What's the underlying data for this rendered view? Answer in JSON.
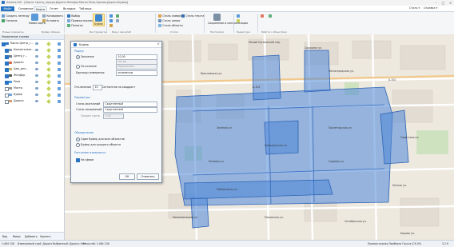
{
  "titlebar": {
    "text": "Axioma.GIS - [Карта: Центр_города.Дороги.ЖелДор.Мосты,Реки,Здания,Дороги,Буфер]"
  },
  "menu": {
    "file": "Файл",
    "tabs": [
      "Основные",
      "Карта",
      "Отчет",
      "Вкладка",
      "Таблица"
    ],
    "active": "Карта",
    "right": [
      "Стиль ▾",
      "Справка ▾"
    ]
  },
  "ribbon": {
    "col1": [
      "Создать легенду",
      "Геолинк"
    ],
    "col2_big": "Новая карта",
    "col3": [
      "Копировать",
      "Вставить"
    ],
    "buffer_label": "Буфер",
    "tools_labels": [
      "Выбор",
      "Прямоугольник",
      "Полигон"
    ],
    "style_items": [
      "Стиль символа",
      "Стиль линии",
      "Стиль области",
      "Стиль текста"
    ],
    "settings_label": "Сохранение и синхронизация",
    "work_items": [
      "Работа с объектами"
    ],
    "groups": [
      "Новые элементы",
      "Буфер обмена",
      "Инструменты",
      "Вид и масштаб",
      "Стили",
      "Настройки",
      "Редактура",
      "Работа с объектами"
    ]
  },
  "panel": {
    "title": "Управление слоями",
    "layers": [
      {
        "label": "Карта Центр_г...",
        "level": 0,
        "checked": true,
        "color": "#2a75c3"
      },
      {
        "label": "Косметическ...",
        "level": 1,
        "checked": true,
        "color": "#8b9db3"
      },
      {
        "label": "Центр_г...",
        "level": 1,
        "checked": true,
        "color": "#6b7d93"
      },
      {
        "label": "Дороги",
        "level": 1,
        "checked": true,
        "color": "#d36b4d"
      },
      {
        "label": "Адм_дел...",
        "level": 1,
        "checked": true,
        "color": "#c2b464"
      },
      {
        "label": "ЖелДор",
        "level": 1,
        "checked": true,
        "color": "#555555"
      },
      {
        "label": "Реки",
        "level": 1,
        "checked": true,
        "color": "#4f9cd9"
      },
      {
        "label": "Мосты",
        "level": 1,
        "checked": false,
        "color": "#9a9a9a"
      },
      {
        "label": "Буфер",
        "level": 1,
        "checked": false,
        "color": "#6ea6e0"
      },
      {
        "label": "Дороги",
        "level": 1,
        "checked": false,
        "color": "#d99a6e"
      }
    ],
    "footer": [
      "Вид",
      "Вверх",
      "Добавить",
      "Удалить"
    ]
  },
  "dialog": {
    "title": "Буфер",
    "radius_group": "Радиус",
    "value_label": "Значение",
    "value": "10,00",
    "value_unit": "метры",
    "by_column_label": "По колонке",
    "by_column_placeholder": "Выражение...",
    "units_label": "Единицы измерения",
    "units_value": "километры",
    "segments_label": "Отклонение",
    "segments_value": "10",
    "segments_suffix": "Сегментов на квадрант",
    "params_group": "Параметры",
    "left_style_label": "Стиль окончаний",
    "left_style_value": "Скругленный",
    "join_style_label": "Стиль соединений",
    "join_style_value": "Скругленный",
    "miter_label": "Предел среза",
    "miter_value": "2,00",
    "combine_group": "Объединение",
    "combine_one": "Один буфер для всех объектов",
    "combine_each": "Буфер для каждого объекта",
    "clip_group": "Растояние измеряется",
    "clip_label": "На сфере",
    "ok": "ОК",
    "cancel": "Отменить"
  },
  "map": {
    "labels": [
      "Малый Купеческий пер.",
      "Сорокина ул.",
      "Ярославская ул.",
      "Ленинградская ул.",
      "Зелёная ул.",
      "Пролетарская ул.",
      "Гражданская ул.",
      "Набережная ул.",
      "А-102",
      "А-102",
      "Перовская ул.",
      "Комсомольская ул.",
      "Советская ул.",
      "Лесная ул.",
      "Садовая ул.",
      "Полевая ул.",
      "Октябрьская ул.",
      "Кирова ул."
    ]
  },
  "status": {
    "scale": "1:464 108",
    "layer": "Изменяемый слой: Дороги",
    "selection": "Выбранный: Дороги: Нет",
    "zoom": "Масштаб: 1:464 108",
    "projection": "Прямоугольная Ламберта Гаусса (СК-95)",
    "coords": "3.2 К"
  },
  "colors": {
    "accent": "#2a75c3",
    "buffer": "#4d86d8",
    "map_bg": "#eee9df"
  }
}
